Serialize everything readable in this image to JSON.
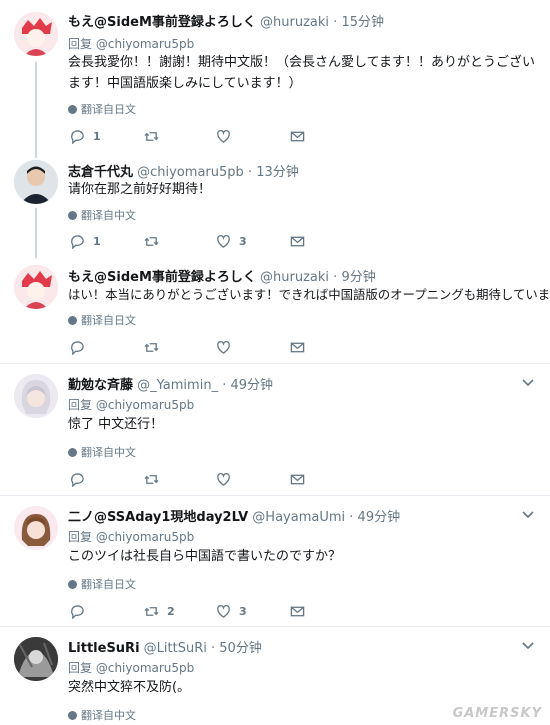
{
  "replies": [
    {
      "name": "もえ@SideM事前登録よろしく",
      "handle": "@huruzaki",
      "time": "15分钟",
      "replying_prefix": "回复",
      "replying_to": "@chiyomaru5pb",
      "text": "会長我愛你！！謝謝！期待中文版！（会長さん愛してます！！ありがとうございます！中国語版楽しみにしています！）",
      "translate": "翻译自日文",
      "reply_count": "1",
      "retweet_count": "",
      "like_count": "",
      "avatar": "anime-girl-avatar"
    },
    {
      "name": "志倉千代丸",
      "handle": "@chiyomaru5pb",
      "time": "13分钟",
      "text": "请你在那之前好好期待！",
      "translate": "翻译自中文",
      "reply_count": "1",
      "retweet_count": "",
      "like_count": "3",
      "avatar": "man-avatar"
    },
    {
      "name": "もえ@SideM事前登録よろしく",
      "handle": "@huruzaki",
      "time": "9分钟",
      "text": "はい！本当にありがとうございます！できれば中国語版のオープニングも期待しています！",
      "translate": "翻译自日文",
      "reply_count": "",
      "retweet_count": "",
      "like_count": "",
      "avatar": "anime-girl-avatar"
    },
    {
      "name": "勤勉な斉藤",
      "handle": "@_Yamimin_",
      "time": "49分钟",
      "replying_prefix": "回复",
      "replying_to": "@chiyomaru5pb",
      "text": "惊了 中文还行！",
      "translate": "翻译自中文",
      "reply_count": "",
      "retweet_count": "",
      "like_count": "",
      "avatar": "silver-hair-avatar"
    },
    {
      "name": "二ノ@SSAday1現地day2LV",
      "handle": "@HayamaUmi",
      "time": "49分钟",
      "replying_prefix": "回复",
      "replying_to": "@chiyomaru5pb",
      "text": "このツイは社長自ら中国語で書いたのですか？",
      "translate": "翻译自日文",
      "reply_count": "",
      "retweet_count": "2",
      "like_count": "3",
      "avatar": "brown-hair-avatar"
    },
    {
      "name": "LittleSuRi",
      "handle": "@LittSuRi",
      "time": "50分钟",
      "replying_prefix": "回复",
      "replying_to": "@chiyomaru5pb",
      "text": "突然中文猝不及防(。",
      "translate": "翻译自中文",
      "avatar": "dark-avatar"
    }
  ],
  "watermark": "GAMERSKY",
  "colors": {
    "text": "#14171a",
    "muted": "#657786",
    "divider": "#e6ecf0",
    "thread": "#ccd6dd"
  },
  "icons": [
    "reply-icon",
    "retweet-icon",
    "like-icon",
    "dm-icon",
    "globe-icon",
    "caret-down-icon"
  ]
}
